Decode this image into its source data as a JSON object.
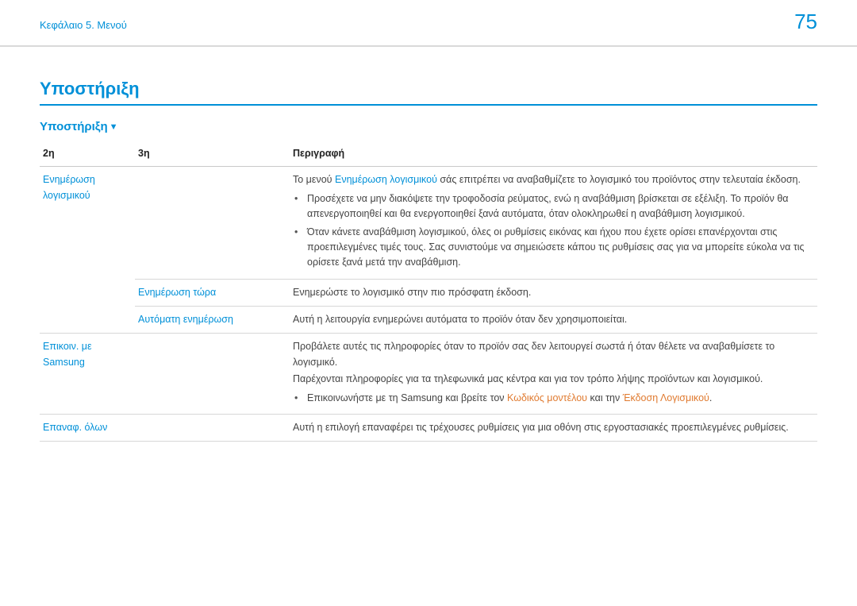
{
  "header": {
    "chapter": "Κεφάλαιο 5. Μενού",
    "page_number": "75"
  },
  "title": "Υποστήριξη",
  "subtitle": "Υποστήριξη",
  "columns": {
    "c2": "2η",
    "c3": "3η",
    "desc": "Περιγραφή"
  },
  "rows": {
    "sw_update": {
      "c2": "Ενημέρωση λογισμικού",
      "desc_intro_pre": "Το μενού ",
      "desc_intro_link": "Ενημέρωση λογισμικού",
      "desc_intro_post": " σάς επιτρέπει να αναβαθμίζετε το λογισμικό του προϊόντος στην τελευταία έκδοση.",
      "b1": "Προσέχετε να μην διακόψετε την τροφοδοσία ρεύματος, ενώ η αναβάθμιση βρίσκεται σε εξέλιξη. Το προϊόν θα απενεργοποιηθεί και θα ενεργοποιηθεί ξανά αυτόματα, όταν ολοκληρωθεί η αναβάθμιση λογισμικού.",
      "b2": "Όταν κάνετε αναβάθμιση λογισμικού, όλες οι ρυθμίσεις εικόνας και ήχου που έχετε ορίσει επανέρχονται στις προεπιλεγμένες τιμές τους. Σας συνιστούμε να σημειώσετε κάπου τις ρυθμίσεις σας για να μπορείτε εύκολα να τις ορίσετε ξανά μετά την αναβάθμιση."
    },
    "update_now": {
      "c3": "Ενημέρωση τώρα",
      "desc": "Ενημερώστε το λογισμικό στην πιο πρόσφατη έκδοση."
    },
    "auto_update": {
      "c3": "Αυτόματη ενημέρωση",
      "desc": "Αυτή η λειτουργία ενημερώνει αυτόματα το προϊόν όταν δεν χρησιμοποιείται."
    },
    "contact": {
      "c2": "Επικοιν. με Samsung",
      "p1": "Προβάλετε αυτές τις πληροφορίες όταν το προϊόν σας δεν λειτουργεί σωστά ή όταν θέλετε να αναβαθμίσετε το λογισμικό.",
      "p2": "Παρέχονται πληροφορίες για τα τηλεφωνικά μας κέντρα και για τον τρόπο λήψης προϊόντων και λογισμικού.",
      "b_pre": "Επικοινωνήστε με τη Samsung και βρείτε τον ",
      "b_link1": "Κωδικός μοντέλου",
      "b_mid": " και την ",
      "b_link2": "Έκδοση Λογισμικού",
      "b_post": "."
    },
    "reset": {
      "c2": "Επαναφ. όλων",
      "desc": "Αυτή η επιλογή επαναφέρει τις τρέχουσες ρυθμίσεις για μια οθόνη στις εργοστασιακές προεπιλεγμένες ρυθμίσεις."
    }
  }
}
